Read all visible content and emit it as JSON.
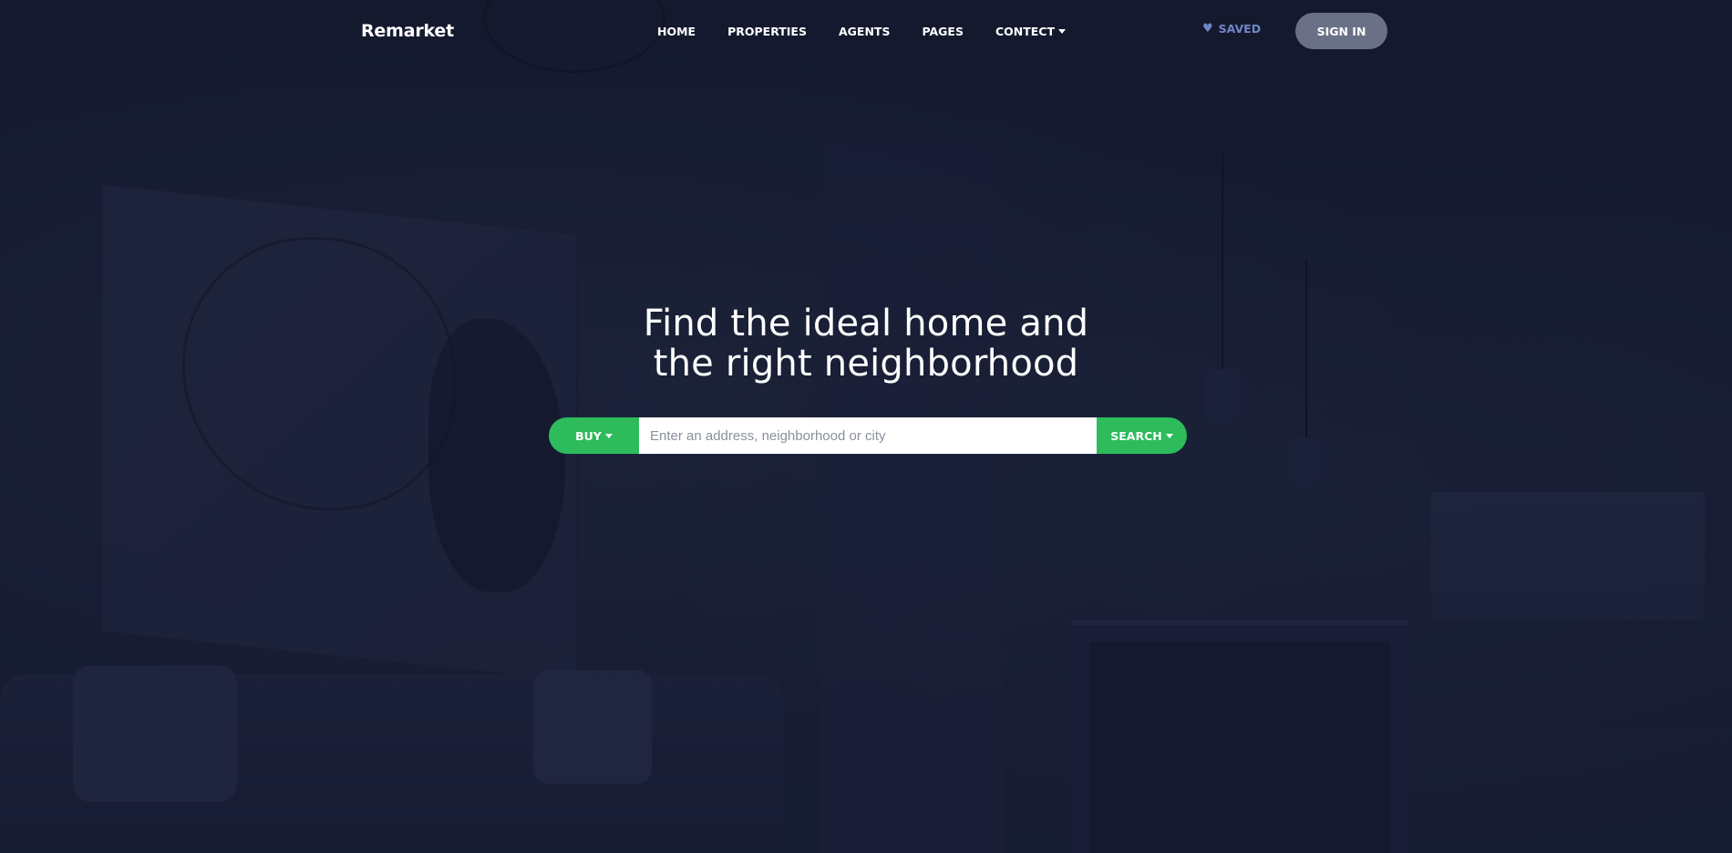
{
  "brand": {
    "name": "Remarket"
  },
  "nav": {
    "items": [
      {
        "label": "HOME"
      },
      {
        "label": "PROPERTIES"
      },
      {
        "label": "AGENTS"
      },
      {
        "label": "PAGES"
      },
      {
        "label": "CONTECT",
        "has_dropdown": true
      }
    ],
    "saved_label": "SAVED",
    "saved_icon": "heart-icon",
    "signin_label": "SIGN IN"
  },
  "hero": {
    "headline_line1": "Find the ideal home and",
    "headline_line2": "the right neighborhood"
  },
  "search": {
    "mode_label": "BUY",
    "input_placeholder": "Enter an address, neighborhood or city",
    "input_value": "",
    "search_label": "SEARCH"
  },
  "colors": {
    "accent_green": "#2dbb5c",
    "saved_blue": "#6f86c6",
    "signin_bg": "#6a7085",
    "background": "#161c31"
  }
}
